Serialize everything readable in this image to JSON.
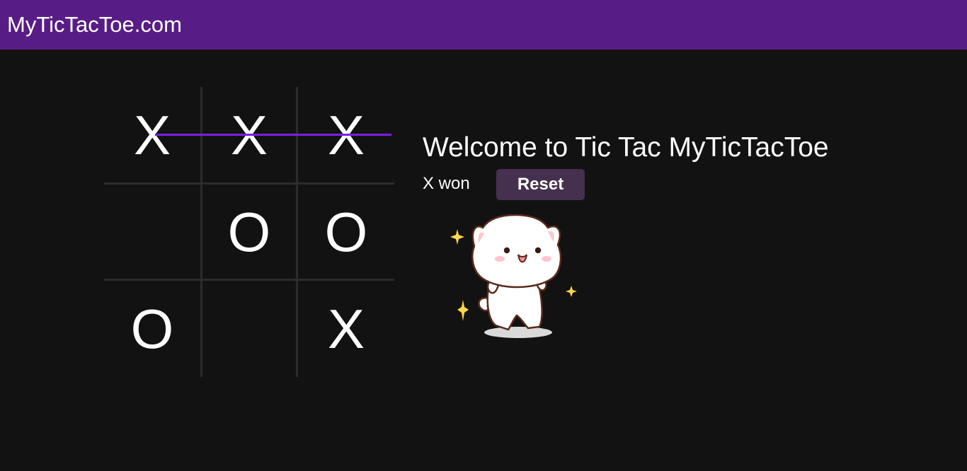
{
  "header": {
    "site_title": "MyTicTacToe.com",
    "background_color": "#581c87"
  },
  "board": {
    "cells": [
      "X",
      "X",
      "X",
      "",
      "O",
      "O",
      "O",
      "",
      "X"
    ],
    "winning_line": "top-row",
    "winning_line_color": "#7a1fe0"
  },
  "panel": {
    "title": "Welcome to Tic Tac MyTicTacToe",
    "status": "X won",
    "reset_label": "Reset",
    "reset_color": "#45304f"
  },
  "sticker": {
    "icon": "dancing-cat-sticker-icon"
  }
}
